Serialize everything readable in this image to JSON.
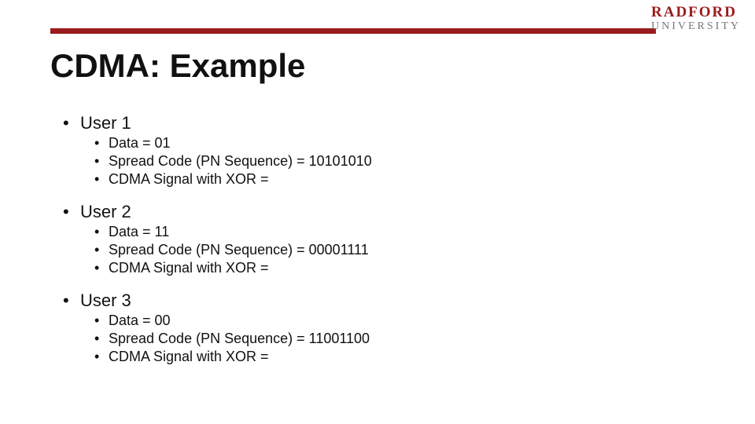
{
  "brand": {
    "name": "RADFORD",
    "sub": "UNIVERSITY"
  },
  "title": "CDMA: Example",
  "users": [
    {
      "heading": "User 1",
      "items": [
        "Data = 01",
        "Spread Code (PN Sequence) = 10101010",
        "CDMA Signal with XOR ="
      ]
    },
    {
      "heading": "User 2",
      "items": [
        "Data = 11",
        "Spread Code (PN Sequence) = 00001111",
        "CDMA Signal with XOR ="
      ]
    },
    {
      "heading": "User 3",
      "items": [
        "Data = 00",
        "Spread Code (PN Sequence) = 11001100",
        "CDMA Signal with XOR ="
      ]
    }
  ]
}
